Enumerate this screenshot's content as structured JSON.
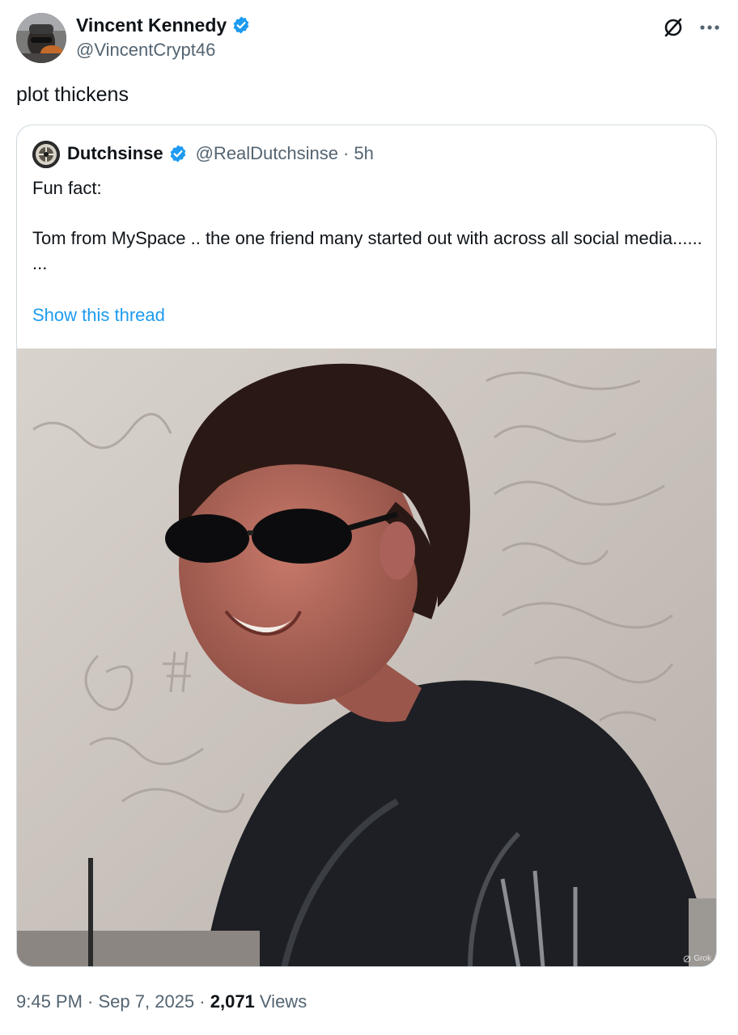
{
  "author": {
    "name": "Vincent Kennedy",
    "handle": "@VincentCrypt46"
  },
  "tweet": {
    "text": "plot thickens"
  },
  "quote": {
    "name": "Dutchsinse",
    "handle": "@RealDutchsinse",
    "separator": "·",
    "age": "5h",
    "line1": "Fun fact:",
    "line2": "Tom from MySpace .. the one friend many started out with across all social media......",
    "line3": "...",
    "show_thread": "Show this thread",
    "image_badge": "Grok"
  },
  "footer": {
    "time": "9:45 PM",
    "sep1": " · ",
    "date": "Sep 7, 2025",
    "sep2": " · ",
    "views_count": "2,071",
    "views_label": " Views"
  },
  "colors": {
    "link": "#1d9bf0",
    "verified": "#1d9bf0",
    "muted": "#536471",
    "text": "#0f1419",
    "border": "#cfd9de"
  },
  "icons": [
    "verified-badge-icon",
    "grok-slash-icon",
    "more-options-icon"
  ]
}
